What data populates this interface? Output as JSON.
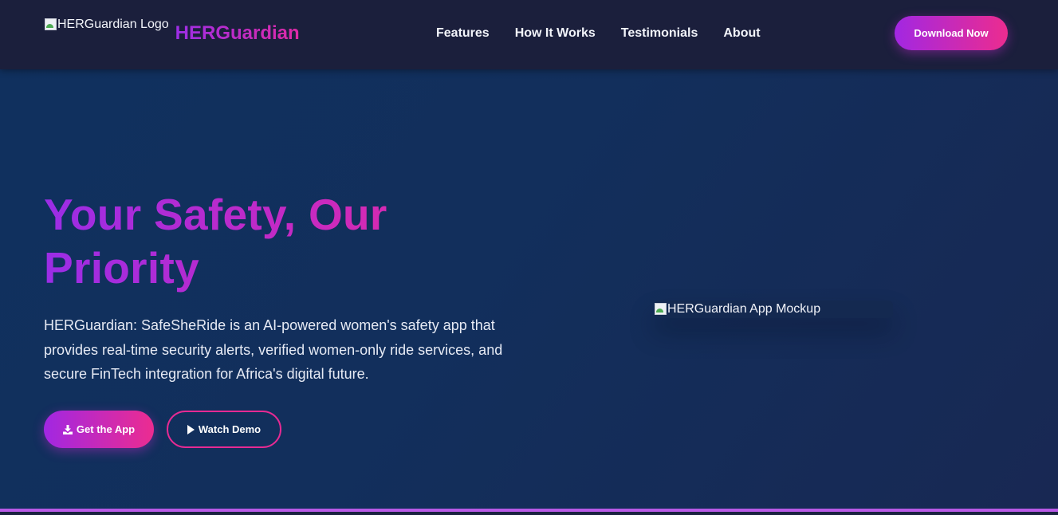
{
  "header": {
    "logo_alt": "HERGuardian Logo",
    "brand_name": "HERGuardian",
    "nav": [
      "Features",
      "How It Works",
      "Testimonials",
      "About"
    ],
    "download_label": "Download Now"
  },
  "hero": {
    "title": "Your Safety, Our Priority",
    "description": "HERGuardian: SafeSheRide is an AI-powered women's safety app that provides real-time security alerts, verified women-only ride services, and secure FinTech integration for Africa's digital future.",
    "primary_button": "Get the App",
    "secondary_button": "Watch Demo",
    "mockup_alt": "HERGuardian App Mockup"
  },
  "icons": {
    "primary_button_icon": "download-icon",
    "secondary_button_icon": "play-icon",
    "broken_image_icon": "broken-image-icon"
  },
  "colors": {
    "header_bg": "#1b1f3c",
    "hero_bg": "#10305e",
    "accent_start": "#a127e2",
    "accent_end": "#ec2c90"
  }
}
